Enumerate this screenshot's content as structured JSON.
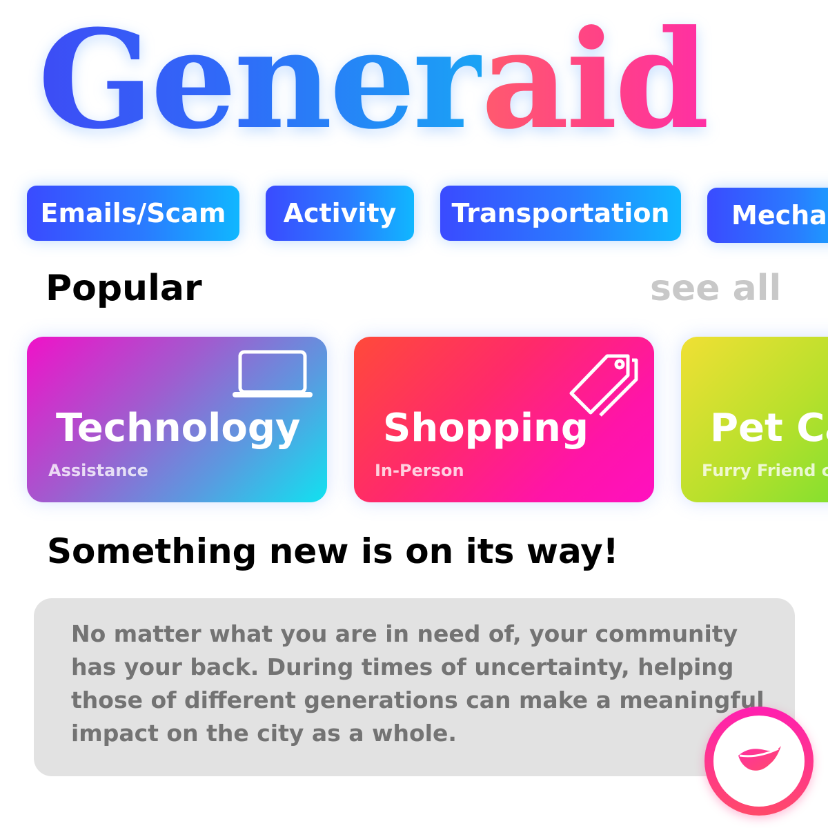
{
  "logo": {
    "part1": "Gener",
    "part2": "aid"
  },
  "categories": [
    {
      "label": "Emails/Scam"
    },
    {
      "label": "Activity"
    },
    {
      "label": "Transportation"
    },
    {
      "label": "Mechan"
    }
  ],
  "popular": {
    "title": "Popular",
    "see_all": "see all",
    "cards": [
      {
        "title": "Technology",
        "subtitle": "Assistance",
        "icon": "laptop-icon"
      },
      {
        "title": "Shopping",
        "subtitle": "In-Person",
        "icon": "price-tag-icon"
      },
      {
        "title": "Pet Ca",
        "subtitle": "Furry Friend c",
        "icon": ""
      }
    ]
  },
  "announcement": {
    "headline": "Something new is on its way!",
    "body": "No matter what you are in need of, your community has your back. During times of uncertainty, helping those of different generations can make a meaningful impact on the city as a whole."
  },
  "fab": {
    "icon": "leaf-lips-icon"
  },
  "colors": {
    "logo_blue": "#3d4cf5",
    "logo_pink": "#ff3f8a",
    "chip_start": "#3a4bff",
    "chip_end": "#10b7ff",
    "see_all": "#c8c8c8",
    "message_bg": "#e2e2e2",
    "message_text": "#737373"
  }
}
